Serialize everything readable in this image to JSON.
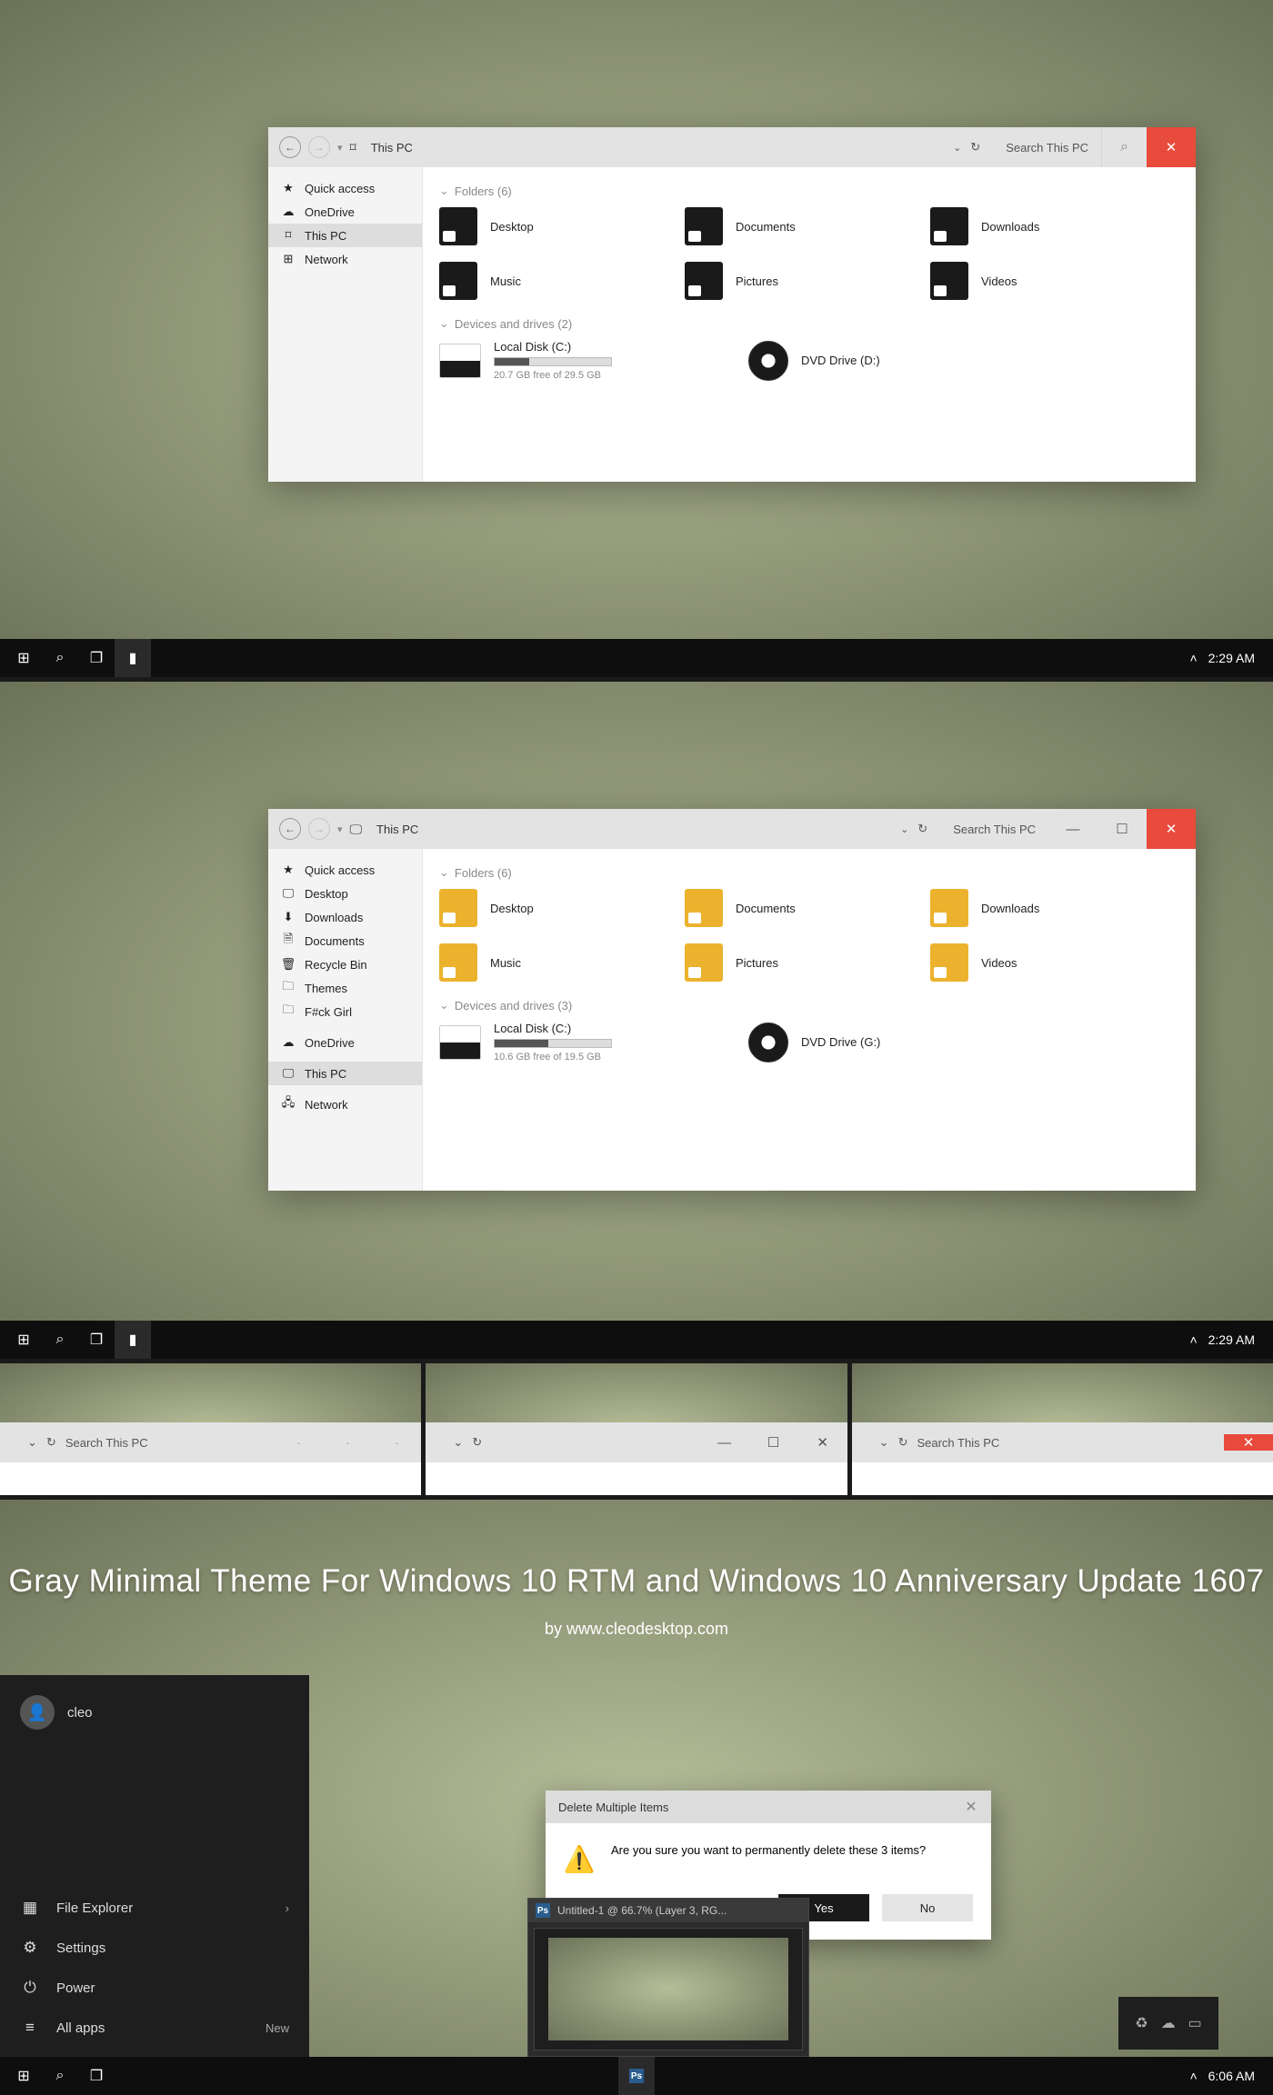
{
  "taskbar": {
    "time1": "2:29 AM",
    "time2": "2:29 AM",
    "time3": "6:06 AM"
  },
  "explorer": {
    "title": "This PC",
    "search": "Search This PC",
    "folders_hdr": "Folders (6)",
    "devices_hdr1": "Devices and drives (2)",
    "devices_hdr2": "Devices and drives (3)",
    "folders": [
      "Desktop",
      "Documents",
      "Downloads",
      "Music",
      "Pictures",
      "Videos"
    ],
    "disk": {
      "label": "Local Disk (C:)",
      "free1": "20.7 GB free of 29.5 GB",
      "free2": "10.6 GB free of 19.5 GB"
    },
    "dvd1": "DVD Drive (D:)",
    "dvd2": "DVD Drive (G:)",
    "side1": [
      "Quick access",
      "OneDrive",
      "This PC",
      "Network"
    ],
    "side2": [
      "Quick access",
      "Desktop",
      "Downloads",
      "Documents",
      "Recycle Bin",
      "Themes",
      "F#ck Girl",
      "OneDrive",
      "This PC",
      "Network"
    ]
  },
  "hero": {
    "title": "Gray Minimal Theme For Windows 10 RTM and Windows 10 Anniversary Update 1607",
    "by": "by www.cleodesktop.com"
  },
  "start": {
    "user": "cleo",
    "items": [
      {
        "icon": "▦",
        "label": "File Explorer",
        "ext": "›"
      },
      {
        "icon": "⚙",
        "label": "Settings",
        "ext": ""
      },
      {
        "icon": "⏻",
        "label": "Power",
        "ext": ""
      },
      {
        "icon": "≡",
        "label": "All apps",
        "ext": "New"
      }
    ]
  },
  "dialog": {
    "title": "Delete Multiple Items",
    "msg": "Are you sure you want to permanently delete these 3 items?",
    "yes": "Yes",
    "no": "No"
  },
  "ps": {
    "title": "Untitled-1 @ 66.7% (Layer 3, RG..."
  }
}
